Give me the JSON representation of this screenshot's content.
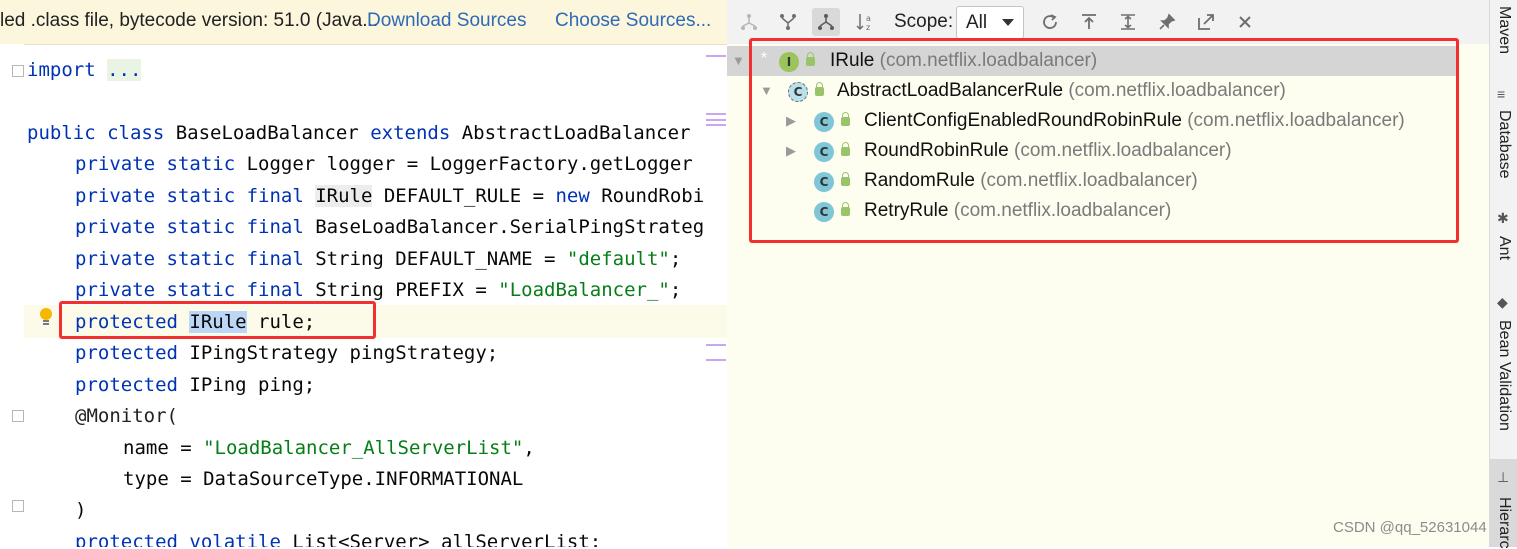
{
  "banner": {
    "message": "led .class file, bytecode version: 51.0 (Java...",
    "download_sources": "Download Sources",
    "choose_sources": "Choose Sources..."
  },
  "code": {
    "l1_import": "import",
    "l1_fold": "...",
    "l2": [
      "public class ",
      "BaseLoadBalancer ",
      "extends ",
      "AbstractLoadBalancer"
    ],
    "l3": [
      "private static ",
      "Logger logger = LoggerFactory.getLogger"
    ],
    "l4": [
      "private static final ",
      "IRule",
      " DEFAULT_RULE = ",
      "new ",
      "RoundRobi"
    ],
    "l5": [
      "private static final ",
      "BaseLoadBalancer.SerialPingStrateg"
    ],
    "l6": [
      "private static final ",
      "String DEFAULT_NAME = ",
      "\"default\"",
      ";"
    ],
    "l7": [
      "private static final ",
      "String PREFIX = ",
      "\"LoadBalancer_\"",
      ";"
    ],
    "l8": [
      "protected ",
      "IRule",
      " rule;"
    ],
    "l9": [
      "protected ",
      "IPingStrategy pingStrategy;"
    ],
    "l10": [
      "protected ",
      "IPing ping;"
    ],
    "l11": "@Monitor(",
    "l12": [
      "name = ",
      "\"LoadBalancer_AllServerList\"",
      ","
    ],
    "l13": "type = DataSourceType.INFORMATIONAL",
    "l14": ")",
    "l15": [
      "protected volatile ",
      "List<Server> allServerList;"
    ]
  },
  "toolbar": {
    "scope_label": "Scope:",
    "scope_value": "All"
  },
  "tree": [
    {
      "name": "IRule",
      "pkg": "(com.netflix.loadbalancer)",
      "kind": "I"
    },
    {
      "name": "AbstractLoadBalancerRule",
      "pkg": "(com.netflix.loadbalancer)",
      "kind": "C"
    },
    {
      "name": "ClientConfigEnabledRoundRobinRule",
      "pkg": "(com.netflix.loadbalancer)",
      "kind": "C"
    },
    {
      "name": "RoundRobinRule",
      "pkg": "(com.netflix.loadbalancer)",
      "kind": "C"
    },
    {
      "name": "RandomRule",
      "pkg": "(com.netflix.loadbalancer)",
      "kind": "C"
    },
    {
      "name": "RetryRule",
      "pkg": "(com.netflix.loadbalancer)",
      "kind": "C"
    }
  ],
  "side_tabs": [
    "Maven",
    "Database",
    "Ant",
    "Bean Validation",
    "Hierarc"
  ],
  "watermark": "CSDN @qq_52631044",
  "colors": {
    "keyword": "#0033b3",
    "string": "#067d17",
    "highlight_box": "#f23030",
    "tree_bg": "#fdfdf0"
  }
}
